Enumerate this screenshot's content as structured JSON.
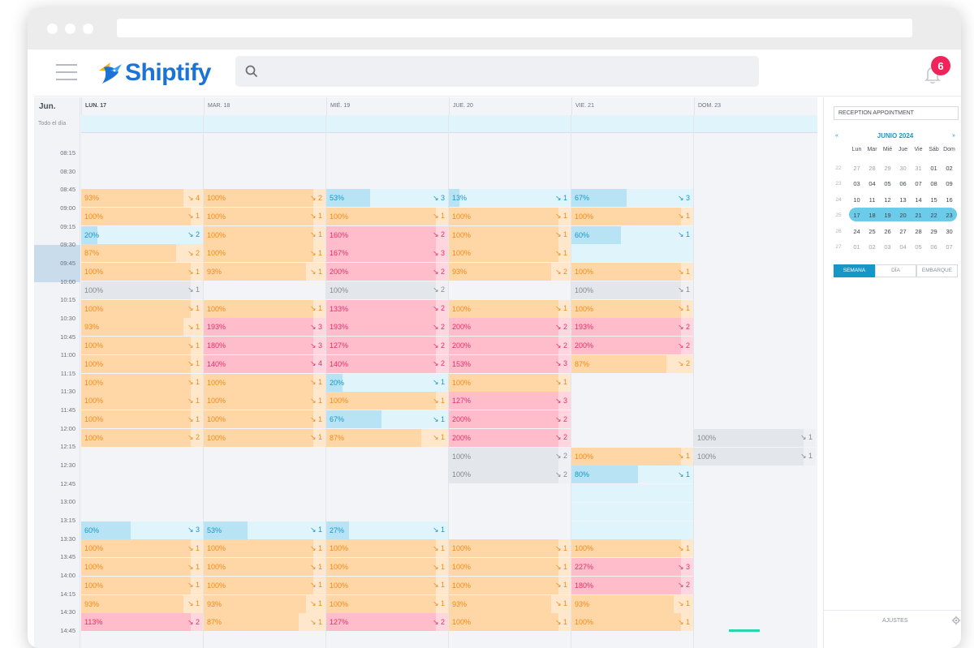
{
  "brand": {
    "name": "Shiptify"
  },
  "notifications": {
    "count": "6"
  },
  "calendar": {
    "month_short": "Jun.",
    "allday_label": "Todo el día",
    "days": [
      "LUN. 17",
      "MAR. 18",
      "MIÉ. 19",
      "JUE. 20",
      "VIE. 21",
      "DOM. 23"
    ],
    "times": [
      "08:15",
      "08:30",
      "08:45",
      "09:00",
      "09:15",
      "09:30",
      "09:45",
      "10:00",
      "10:15",
      "10:30",
      "10:45",
      "11:00",
      "11:15",
      "11:30",
      "11:45",
      "12:00",
      "12:15",
      "12:30",
      "12:45",
      "13:00",
      "13:15",
      "13:30",
      "13:45",
      "14:00",
      "14:15",
      "14:30",
      "14:45"
    ],
    "columns": [
      [
        {
          "row": 0,
          "pct": "93%",
          "count": "4",
          "fill": 93,
          "color": "or"
        },
        {
          "row": 1,
          "pct": "100%",
          "count": "1",
          "fill": 100,
          "color": "or"
        },
        {
          "row": 2,
          "pct": "20%",
          "count": "2",
          "fill": 20,
          "color": "bl"
        },
        {
          "row": 3,
          "pct": "87%",
          "count": "2",
          "fill": 87,
          "color": "or"
        },
        {
          "row": 4,
          "pct": "100%",
          "count": "1",
          "fill": 100,
          "color": "or"
        },
        {
          "row": 5,
          "pct": "100%",
          "count": "1",
          "fill": 100,
          "color": "gr"
        },
        {
          "row": 6,
          "pct": "100%",
          "count": "1",
          "fill": 100,
          "color": "or"
        },
        {
          "row": 7,
          "pct": "93%",
          "count": "1",
          "fill": 93,
          "color": "or"
        },
        {
          "row": 8,
          "pct": "100%",
          "count": "1",
          "fill": 100,
          "color": "or"
        },
        {
          "row": 9,
          "pct": "100%",
          "count": "1",
          "fill": 100,
          "color": "or"
        },
        {
          "row": 10,
          "pct": "100%",
          "count": "1",
          "fill": 100,
          "color": "or"
        },
        {
          "row": 11,
          "pct": "100%",
          "count": "1",
          "fill": 100,
          "color": "or"
        },
        {
          "row": 12,
          "pct": "100%",
          "count": "1",
          "fill": 100,
          "color": "or"
        },
        {
          "row": 13,
          "pct": "100%",
          "count": "2",
          "fill": 100,
          "color": "or"
        },
        {
          "row": 18,
          "pct": "60%",
          "count": "3",
          "fill": 60,
          "color": "bl"
        },
        {
          "row": 19,
          "pct": "100%",
          "count": "1",
          "fill": 100,
          "color": "or"
        },
        {
          "row": 20,
          "pct": "100%",
          "count": "1",
          "fill": 100,
          "color": "or"
        },
        {
          "row": 21,
          "pct": "100%",
          "count": "1",
          "fill": 100,
          "color": "or"
        },
        {
          "row": 22,
          "pct": "93%",
          "count": "1",
          "fill": 93,
          "color": "or"
        },
        {
          "row": 23,
          "pct": "113%",
          "count": "2",
          "fill": 100,
          "color": "pk"
        }
      ],
      [
        {
          "row": 0,
          "pct": "100%",
          "count": "2",
          "fill": 100,
          "color": "or"
        },
        {
          "row": 1,
          "pct": "100%",
          "count": "1",
          "fill": 100,
          "color": "or"
        },
        {
          "row": 2,
          "pct": "100%",
          "count": "1",
          "fill": 100,
          "color": "or"
        },
        {
          "row": 3,
          "pct": "100%",
          "count": "1",
          "fill": 100,
          "color": "or"
        },
        {
          "row": 4,
          "pct": "93%",
          "count": "1",
          "fill": 93,
          "color": "or"
        },
        {
          "row": 6,
          "pct": "100%",
          "count": "1",
          "fill": 100,
          "color": "or"
        },
        {
          "row": 7,
          "pct": "193%",
          "count": "3",
          "fill": 100,
          "color": "pk"
        },
        {
          "row": 8,
          "pct": "180%",
          "count": "3",
          "fill": 100,
          "color": "pk"
        },
        {
          "row": 9,
          "pct": "140%",
          "count": "4",
          "fill": 100,
          "color": "pk"
        },
        {
          "row": 10,
          "pct": "100%",
          "count": "1",
          "fill": 100,
          "color": "or"
        },
        {
          "row": 11,
          "pct": "100%",
          "count": "1",
          "fill": 100,
          "color": "or"
        },
        {
          "row": 12,
          "pct": "100%",
          "count": "1",
          "fill": 100,
          "color": "or"
        },
        {
          "row": 13,
          "pct": "100%",
          "count": "1",
          "fill": 100,
          "color": "or"
        },
        {
          "row": 18,
          "pct": "53%",
          "count": "1",
          "fill": 53,
          "color": "bl"
        },
        {
          "row": 19,
          "pct": "100%",
          "count": "1",
          "fill": 100,
          "color": "or"
        },
        {
          "row": 20,
          "pct": "100%",
          "count": "1",
          "fill": 100,
          "color": "or"
        },
        {
          "row": 21,
          "pct": "100%",
          "count": "1",
          "fill": 100,
          "color": "or"
        },
        {
          "row": 22,
          "pct": "93%",
          "count": "1",
          "fill": 93,
          "color": "or"
        },
        {
          "row": 23,
          "pct": "87%",
          "count": "1",
          "fill": 87,
          "color": "or"
        }
      ],
      [
        {
          "row": 0,
          "pct": "53%",
          "count": "3",
          "fill": 53,
          "color": "bl"
        },
        {
          "row": 1,
          "pct": "100%",
          "count": "1",
          "fill": 100,
          "color": "or"
        },
        {
          "row": 2,
          "pct": "160%",
          "count": "2",
          "fill": 100,
          "color": "pk"
        },
        {
          "row": 3,
          "pct": "167%",
          "count": "3",
          "fill": 100,
          "color": "pk"
        },
        {
          "row": 4,
          "pct": "200%",
          "count": "2",
          "fill": 100,
          "color": "pk"
        },
        {
          "row": 5,
          "pct": "100%",
          "count": "2",
          "fill": 100,
          "color": "gr"
        },
        {
          "row": 6,
          "pct": "133%",
          "count": "2",
          "fill": 100,
          "color": "pk"
        },
        {
          "row": 7,
          "pct": "193%",
          "count": "2",
          "fill": 100,
          "color": "pk"
        },
        {
          "row": 8,
          "pct": "127%",
          "count": "2",
          "fill": 100,
          "color": "pk"
        },
        {
          "row": 9,
          "pct": "140%",
          "count": "2",
          "fill": 100,
          "color": "pk"
        },
        {
          "row": 10,
          "pct": "20%",
          "count": "1",
          "fill": 20,
          "color": "bl"
        },
        {
          "row": 11,
          "pct": "100%",
          "count": "1",
          "fill": 100,
          "color": "or"
        },
        {
          "row": 12,
          "pct": "67%",
          "count": "1",
          "fill": 67,
          "color": "bl"
        },
        {
          "row": 13,
          "pct": "87%",
          "count": "1",
          "fill": 87,
          "color": "or"
        },
        {
          "row": 18,
          "pct": "27%",
          "count": "1",
          "fill": 27,
          "color": "bl"
        },
        {
          "row": 19,
          "pct": "100%",
          "count": "1",
          "fill": 100,
          "color": "or"
        },
        {
          "row": 20,
          "pct": "100%",
          "count": "1",
          "fill": 100,
          "color": "or"
        },
        {
          "row": 21,
          "pct": "100%",
          "count": "1",
          "fill": 100,
          "color": "or"
        },
        {
          "row": 22,
          "pct": "100%",
          "count": "1",
          "fill": 100,
          "color": "or"
        },
        {
          "row": 23,
          "pct": "127%",
          "count": "2",
          "fill": 100,
          "color": "pk"
        }
      ],
      [
        {
          "row": 0,
          "pct": "13%",
          "count": "1",
          "fill": 13,
          "color": "bl"
        },
        {
          "row": 1,
          "pct": "100%",
          "count": "1",
          "fill": 100,
          "color": "or"
        },
        {
          "row": 2,
          "pct": "100%",
          "count": "1",
          "fill": 100,
          "color": "or"
        },
        {
          "row": 3,
          "pct": "100%",
          "count": "1",
          "fill": 100,
          "color": "or"
        },
        {
          "row": 4,
          "pct": "93%",
          "count": "2",
          "fill": 93,
          "color": "or"
        },
        {
          "row": 6,
          "pct": "100%",
          "count": "1",
          "fill": 100,
          "color": "or"
        },
        {
          "row": 7,
          "pct": "200%",
          "count": "2",
          "fill": 100,
          "color": "pk"
        },
        {
          "row": 8,
          "pct": "200%",
          "count": "2",
          "fill": 100,
          "color": "pk"
        },
        {
          "row": 9,
          "pct": "153%",
          "count": "3",
          "fill": 100,
          "color": "pk"
        },
        {
          "row": 10,
          "pct": "100%",
          "count": "1",
          "fill": 100,
          "color": "or"
        },
        {
          "row": 11,
          "pct": "127%",
          "count": "3",
          "fill": 100,
          "color": "pk"
        },
        {
          "row": 12,
          "pct": "200%",
          "count": "2",
          "fill": 100,
          "color": "pk"
        },
        {
          "row": 13,
          "pct": "200%",
          "count": "2",
          "fill": 100,
          "color": "pk"
        },
        {
          "row": 14,
          "pct": "100%",
          "count": "2",
          "fill": 100,
          "color": "gr"
        },
        {
          "row": 15,
          "pct": "100%",
          "count": "2",
          "fill": 100,
          "color": "gr"
        },
        {
          "row": 19,
          "pct": "100%",
          "count": "1",
          "fill": 100,
          "color": "or"
        },
        {
          "row": 20,
          "pct": "100%",
          "count": "1",
          "fill": 100,
          "color": "or"
        },
        {
          "row": 21,
          "pct": "100%",
          "count": "1",
          "fill": 100,
          "color": "or"
        },
        {
          "row": 22,
          "pct": "93%",
          "count": "1",
          "fill": 93,
          "color": "or"
        },
        {
          "row": 23,
          "pct": "100%",
          "count": "1",
          "fill": 100,
          "color": "or"
        }
      ],
      [
        {
          "row": 0,
          "pct": "67%",
          "count": "3",
          "fill": 67,
          "color": "bl"
        },
        {
          "row": 1,
          "pct": "100%",
          "count": "1",
          "fill": 100,
          "color": "or"
        },
        {
          "row": 2,
          "pct": "60%",
          "count": "1",
          "fill": 60,
          "color": "bl"
        },
        {
          "row": 3,
          "pct": "",
          "count": "",
          "fill": 0,
          "color": "em"
        },
        {
          "row": 4,
          "pct": "100%",
          "count": "1",
          "fill": 100,
          "color": "or"
        },
        {
          "row": 5,
          "pct": "100%",
          "count": "1",
          "fill": 100,
          "color": "gr"
        },
        {
          "row": 6,
          "pct": "100%",
          "count": "1",
          "fill": 100,
          "color": "or"
        },
        {
          "row": 7,
          "pct": "193%",
          "count": "2",
          "fill": 100,
          "color": "pk"
        },
        {
          "row": 8,
          "pct": "200%",
          "count": "2",
          "fill": 100,
          "color": "pk"
        },
        {
          "row": 9,
          "pct": "87%",
          "count": "2",
          "fill": 87,
          "color": "or"
        },
        {
          "row": 14,
          "pct": "100%",
          "count": "1",
          "fill": 100,
          "color": "or"
        },
        {
          "row": 15,
          "pct": "80%",
          "count": "1",
          "fill": 80,
          "color": "bl"
        },
        {
          "row": 16,
          "pct": "",
          "count": "",
          "fill": 0,
          "color": "em"
        },
        {
          "row": 17,
          "pct": "",
          "count": "",
          "fill": 0,
          "color": "em"
        },
        {
          "row": 18,
          "pct": "",
          "count": "",
          "fill": 0,
          "color": "em"
        },
        {
          "row": 19,
          "pct": "100%",
          "count": "1",
          "fill": 100,
          "color": "or"
        },
        {
          "row": 20,
          "pct": "227%",
          "count": "3",
          "fill": 100,
          "color": "pk"
        },
        {
          "row": 21,
          "pct": "180%",
          "count": "2",
          "fill": 100,
          "color": "pk"
        },
        {
          "row": 22,
          "pct": "93%",
          "count": "1",
          "fill": 93,
          "color": "or"
        },
        {
          "row": 23,
          "pct": "100%",
          "count": "1",
          "fill": 100,
          "color": "or"
        }
      ],
      [
        {
          "row": 13,
          "pct": "100%",
          "count": "1",
          "fill": 100,
          "color": "gr"
        },
        {
          "row": 14,
          "pct": "100%",
          "count": "1",
          "fill": 100,
          "color": "gr"
        }
      ]
    ]
  },
  "sidebar": {
    "select_label": "RECEPTION APPOINTMENT",
    "mini_title": "JUNIO 2024",
    "prev": "«",
    "next": "»",
    "weekdays": [
      "Lun",
      "Mar",
      "Mié",
      "Jue",
      "Vie",
      "Sáb",
      "Dom"
    ],
    "weeks": [
      {
        "wk": "22",
        "days": [
          "27",
          "28",
          "29",
          "30",
          "31",
          "01",
          "02"
        ],
        "muted": [
          true,
          true,
          true,
          true,
          true,
          false,
          false
        ]
      },
      {
        "wk": "23",
        "days": [
          "03",
          "04",
          "05",
          "06",
          "07",
          "08",
          "09"
        ],
        "muted": [
          false,
          false,
          false,
          false,
          false,
          false,
          false
        ]
      },
      {
        "wk": "24",
        "days": [
          "10",
          "11",
          "12",
          "13",
          "14",
          "15",
          "16"
        ],
        "muted": [
          false,
          false,
          false,
          false,
          false,
          false,
          false
        ]
      },
      {
        "wk": "25",
        "days": [
          "17",
          "18",
          "19",
          "20",
          "21",
          "22",
          "23"
        ],
        "muted": [
          false,
          false,
          false,
          false,
          false,
          false,
          false
        ]
      },
      {
        "wk": "26",
        "days": [
          "24",
          "25",
          "26",
          "27",
          "28",
          "29",
          "30"
        ],
        "muted": [
          false,
          false,
          false,
          false,
          false,
          false,
          false
        ]
      },
      {
        "wk": "27",
        "days": [
          "01",
          "02",
          "03",
          "04",
          "05",
          "06",
          "07"
        ],
        "muted": [
          true,
          true,
          true,
          true,
          true,
          true,
          true
        ]
      }
    ],
    "view_buttons": [
      "SEMANA",
      "DÍA",
      "EMBARQUE"
    ],
    "active_view": "SEMANA",
    "footer_label": "AJUSTES"
  },
  "colors": {
    "brand_blue": "#1b73d6",
    "accent_cyan": "#1797c8",
    "badge_red": "#f0245a",
    "orange": "#f08a1a",
    "pink": "#e5306b"
  }
}
